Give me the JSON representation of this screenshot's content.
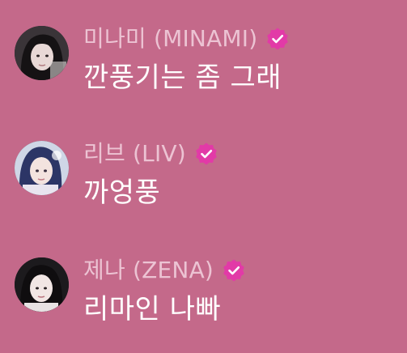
{
  "colors": {
    "background": "#c4698a",
    "sender_name": "#ecc3d3",
    "message_text": "#ffffff",
    "verified_badge": "#e23aa7"
  },
  "messages": [
    {
      "sender": "미나미 (MINAMI)",
      "text": "깐풍기는 좀 그래",
      "verified": true,
      "avatar": "avatar-minami",
      "badge_icon": "verified-badge-icon"
    },
    {
      "sender": "리브 (LIV)",
      "text": "까엉풍",
      "verified": true,
      "avatar": "avatar-liv",
      "badge_icon": "verified-badge-icon"
    },
    {
      "sender": "제나 (ZENA)",
      "text": "리마인 나빠",
      "verified": true,
      "avatar": "avatar-zena",
      "badge_icon": "verified-badge-icon"
    }
  ]
}
